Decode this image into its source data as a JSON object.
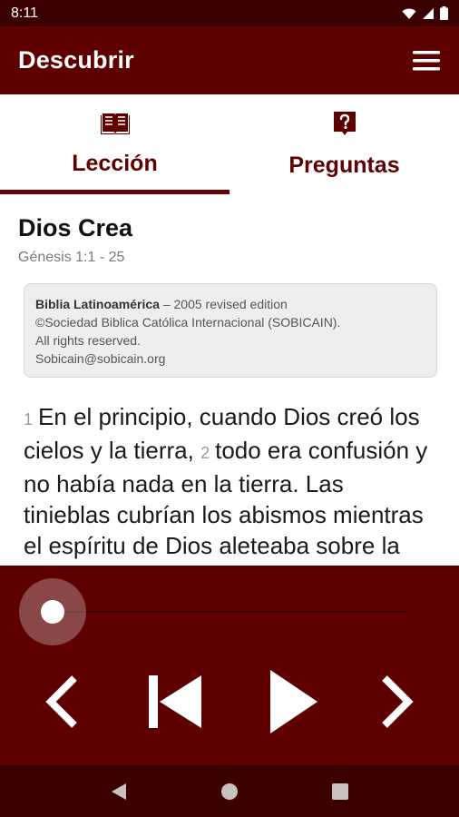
{
  "status_bar": {
    "time": "8:11",
    "icons": [
      "wifi-icon",
      "cell-signal-icon",
      "battery-icon"
    ]
  },
  "app_bar": {
    "title": "Descubrir",
    "menu_icon": "hamburger-menu-icon"
  },
  "tabs": [
    {
      "label": "Lección",
      "icon": "book-icon",
      "selected": true
    },
    {
      "label": "Preguntas",
      "icon": "question-icon",
      "selected": false
    }
  ],
  "lesson": {
    "title": "Dios Crea",
    "reference": "Génesis 1:1 - 25",
    "copyright": {
      "bible_name": "Biblia Latinoamérica",
      "edition": " – 2005 revised edition",
      "publisher": "©Sociedad Biblica Católica Internacional (SOBICAIN).",
      "rights": "All rights reserved.",
      "email": "Sobicain@sobicain.org"
    },
    "verses": [
      {
        "num": "1",
        "text": "En el principio, cuando Dios creó los cielos y la tierra,"
      },
      {
        "num": "2",
        "text": "todo era confusión y no había nada en la tierra. Las tinieblas cubrían los abismos mientras el espíritu de Dios aleteaba sobre la superficie de las aguas."
      }
    ]
  },
  "player": {
    "progress": 0.0,
    "controls": [
      "previous-chapter-icon",
      "skip-to-start-icon",
      "play-icon",
      "next-chapter-icon"
    ]
  },
  "nav_bar": {
    "buttons": [
      "back-triangle-icon",
      "home-circle-icon",
      "recents-square-icon"
    ]
  },
  "colors": {
    "primary": "#5e0000",
    "primary_dark": "#3b0000",
    "text": "#1a1a1a",
    "muted": "#7a7a7a"
  }
}
